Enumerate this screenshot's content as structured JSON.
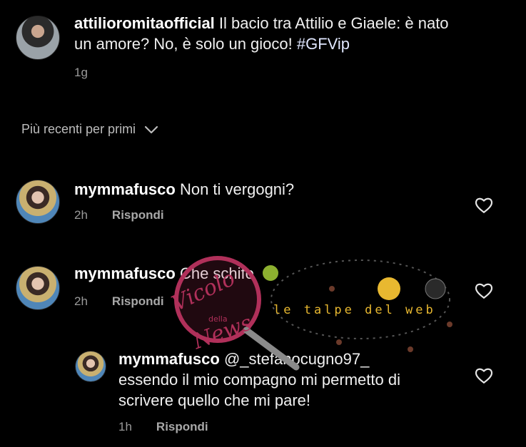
{
  "post": {
    "username": "attilioromitaofficial",
    "caption_line1": " Il bacio tra Attilio e Giaele: è nato",
    "caption_line2": "un amore? No, è solo un gioco! ",
    "hashtag": "#GFVip",
    "time": "1g"
  },
  "sort": {
    "label": "Più recenti per primi",
    "icon": "chevron-down-icon"
  },
  "comments": [
    {
      "username": "mymmafusco",
      "text": " Non ti vergogni?",
      "time": "2h",
      "reply_label": "Rispondi"
    },
    {
      "username": "mymmafusco",
      "text": " Che schifo ",
      "emoji": "nauseated-face-emoji",
      "time": "2h",
      "reply_label": "Rispondi"
    },
    {
      "username": "mymmafusco",
      "mention": " @_stefanocugno97_",
      "text_line1": "essendo il mio compagno mi permetto di",
      "text_line2": "scrivere quello che mi pare!",
      "time": "1h",
      "reply_label": "Rispondi"
    }
  ],
  "watermarks": {
    "vicolo_line1": "Vicolo",
    "vicolo_line2": "della",
    "vicolo_line3": "News",
    "talpe": "le talpe del web"
  },
  "colors": {
    "background": "#000000",
    "text": "#f2f2f2",
    "muted": "#9a9a9a",
    "watermark_pink": "#b0305a",
    "talpe_yellow": "#e8b830"
  }
}
